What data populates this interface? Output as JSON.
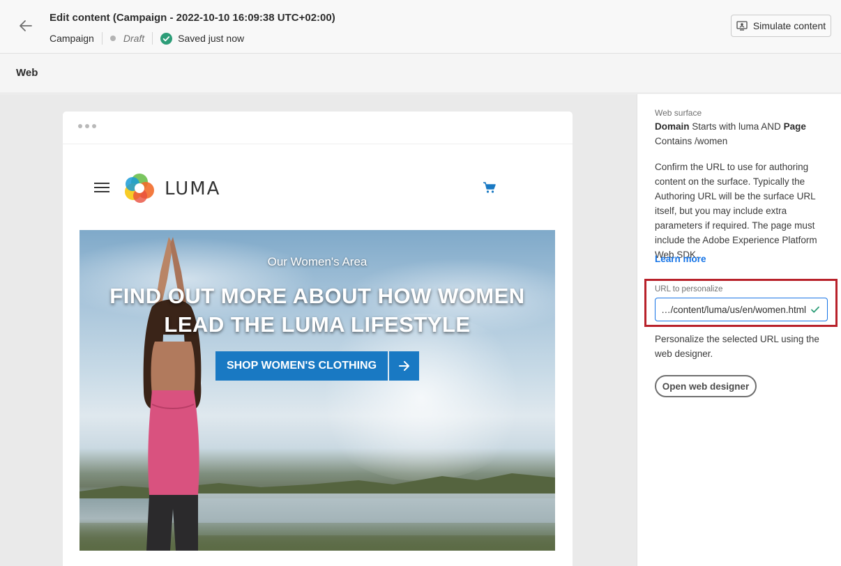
{
  "header": {
    "title": "Edit content (Campaign - 2022-10-10 16:09:38 UTC+02:00)",
    "breadcrumb": "Campaign",
    "status": "Draft",
    "save_status": "Saved just now",
    "simulate_label": "Simulate content"
  },
  "subheader": {
    "channel_label": "Web"
  },
  "preview": {
    "brand": "LUMA",
    "hero_subtitle": "Our Women's Area",
    "hero_title_line1": "FIND OUT MORE ABOUT HOW WOMEN",
    "hero_title_line2": "LEAD THE LUMA LIFESTYLE",
    "cta_label": "SHOP WOMEN'S CLOTHING"
  },
  "panel": {
    "surface_label": "Web surface",
    "surface_domain_key": "Domain",
    "surface_domain_rule": " Starts with luma AND ",
    "surface_page_key": "Page",
    "surface_page_rule": "Contains /women",
    "description": "Confirm the URL to use for authoring content on the surface. Typically the Authoring URL will be the surface URL itself, but you may include extra parameters if required. The page must include the Adobe Experience Platform Web SDK.",
    "learn_more": "Learn more",
    "url_label": "URL to personalize",
    "url_value": "⁨…/content/luma/us/en/women.html⁩",
    "personalize_text": "Personalize the selected URL using the web designer.",
    "open_designer_label": "Open web designer"
  },
  "colors": {
    "accent": "#1473e6",
    "highlight": "#b8212a",
    "cta": "#1979c3",
    "success": "#2d9d78"
  }
}
